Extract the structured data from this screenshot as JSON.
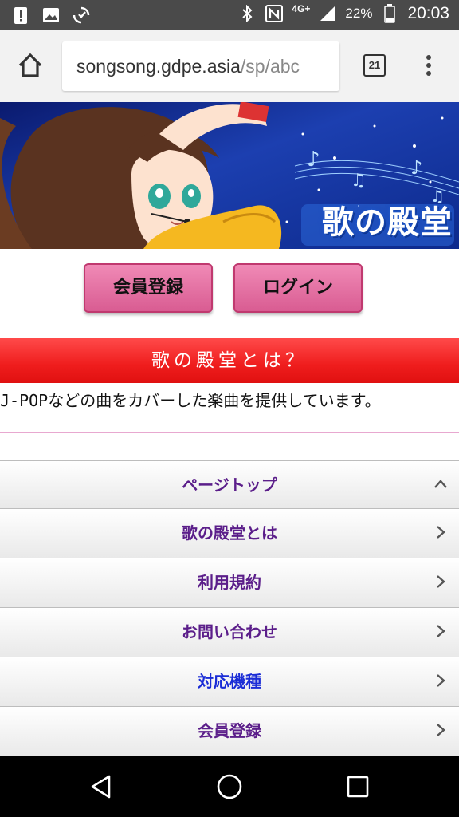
{
  "status_bar": {
    "time": "20:03",
    "battery": "22%",
    "network": "4G+",
    "icons": [
      "alert-icon",
      "image-icon",
      "sync-icon",
      "bluetooth-icon",
      "nfc-icon",
      "signal-icon",
      "battery-icon"
    ]
  },
  "browser": {
    "url_host": "songsong.gdpe.asia",
    "url_path": "/sp/abc",
    "tab_count": "21"
  },
  "banner": {
    "logo_text": "歌の殿堂"
  },
  "auth": {
    "register_label": "会員登録",
    "login_label": "ログイン"
  },
  "about": {
    "heading": "歌の殿堂とは？",
    "description": "J-POPなどの曲をカバーした楽曲を提供しています。"
  },
  "menu": {
    "items": [
      {
        "label": "ページトップ",
        "icon": "chevron-up-icon"
      },
      {
        "label": "歌の殿堂とは",
        "icon": "chevron-right-icon"
      },
      {
        "label": "利用規約",
        "icon": "chevron-right-icon"
      },
      {
        "label": "お問い合わせ",
        "icon": "chevron-right-icon"
      },
      {
        "label": "対応機種",
        "icon": "chevron-right-icon"
      },
      {
        "label": "会員登録",
        "icon": "chevron-right-icon"
      }
    ]
  },
  "colors": {
    "status_bar": "#4a4a4a",
    "toolbar": "#f2f2f2",
    "auth_button": "#e0699d",
    "about_header": "#f02a2a",
    "menu_text": "#5b1e8a",
    "menu_text_blue": "#1a2cd6"
  }
}
